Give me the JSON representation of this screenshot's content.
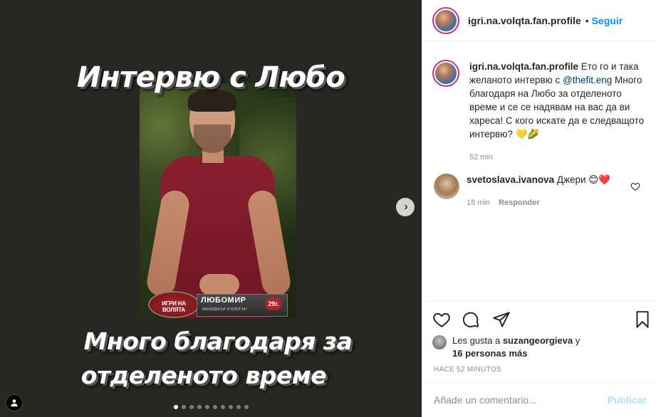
{
  "media": {
    "headline_top": "Интервю с Любо",
    "headline_bottom_1": "Много благодаря за",
    "headline_bottom_2": "отделеното време",
    "banner_badge": "ИГРИ НА ВОЛЯТА",
    "banner_name": "ЛЮБОМИР",
    "banner_subtitle": "МЕНИДЖЪР И БЛОГЪР",
    "banner_age": "29г.",
    "next_icon": "chevron-right-icon",
    "carousel_dots": 10,
    "carousel_active_index": 0
  },
  "header": {
    "username": "igri.na.volqta.fan.profile",
    "separator": "•",
    "follow_label": "Seguir"
  },
  "caption": {
    "username": "igri.na.volqta.fan.profile",
    "text_before": " Ето го и така желаното интервю с ",
    "mention": "@thefit.eng",
    "text_after": " Много благодаря на Любо за отделеното време и се се надявам на вас да ви хареса! С кого искате да е следващото интервю? 💛🌽",
    "time": "52 min"
  },
  "comment": {
    "username": "svetoslava.ivanova",
    "text": " Джери 😊❤️",
    "time": "18 min",
    "reply_label": "Responder"
  },
  "likes": {
    "prefix": "Les gusta a ",
    "user": "suzangeorgieva",
    "middle": " y",
    "count": "16 personas más"
  },
  "timestamp": "HACE 52 MINUTOS",
  "add_comment": {
    "placeholder": "Añade un comentario...",
    "post_label": "Publicar"
  },
  "colors": {
    "accent": "#0095f6",
    "post_disabled": "#b2dffc",
    "media_bg": "#272723"
  }
}
